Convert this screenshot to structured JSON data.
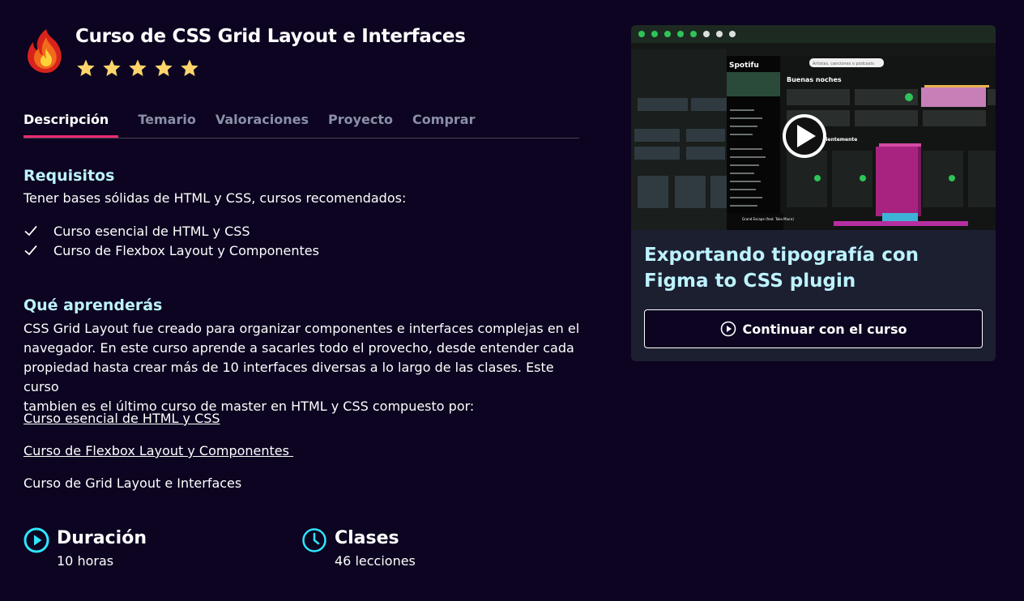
{
  "course": {
    "title": "Curso de CSS Grid Layout e Interfaces",
    "rating": 5,
    "logo_icon": "fire-icon"
  },
  "tabs": [
    {
      "label": "Descripción",
      "active": true
    },
    {
      "label": "Temario",
      "active": false
    },
    {
      "label": "Valoraciones",
      "active": false
    },
    {
      "label": "Proyecto",
      "active": false
    },
    {
      "label": "Comprar",
      "active": false
    }
  ],
  "requirements": {
    "heading": "Requisitos",
    "intro": "Tener bases sólidas de HTML y CSS, cursos recomendados:",
    "items": [
      "Curso esencial de HTML y CSS",
      "Curso de Flexbox Layout y Componentes"
    ]
  },
  "learn": {
    "heading": "Qué aprenderás",
    "lines": [
      "CSS Grid Layout fue creado para organizar componentes e interfaces complejas en el",
      "navegador. En este curso aprende a sacarles todo el provecho, desde entender cada",
      "propiedad hasta crear más de 10 interfaces diversas a lo largo de las clases. Este curso",
      "tambien es el último curso de master en HTML y CSS compuesto por:"
    ],
    "links": [
      "Curso esencial de HTML y CSS",
      "Curso de Flexbox Layout y Componentes "
    ],
    "current": "Curso de Grid Layout e Interfaces"
  },
  "stats": {
    "duration": {
      "label": "Duración",
      "value": "10 horas",
      "icon": "play-circle-icon"
    },
    "classes": {
      "label": "Clases",
      "value": "46 lecciones",
      "icon": "clock-icon"
    }
  },
  "card": {
    "lesson_title": "Exportando tipografía con Figma to CSS plugin",
    "button_label": "Continuar con el curso",
    "thumbnail": {
      "app_name": "Spotifu",
      "greeting": "Buenas noches",
      "search_placeholder": "Artistas, canciones o podcasts",
      "section": "Escuchado recientemente",
      "now_playing": "Grand Escape (feat. Toko Miura)"
    }
  },
  "colors": {
    "background": "#0c0420",
    "accent": "#ed2b6f",
    "heading": "#bdf3ff",
    "icon_cyan": "#2fe5ff",
    "star": "#ffd56b",
    "card": "#1c1f30"
  }
}
